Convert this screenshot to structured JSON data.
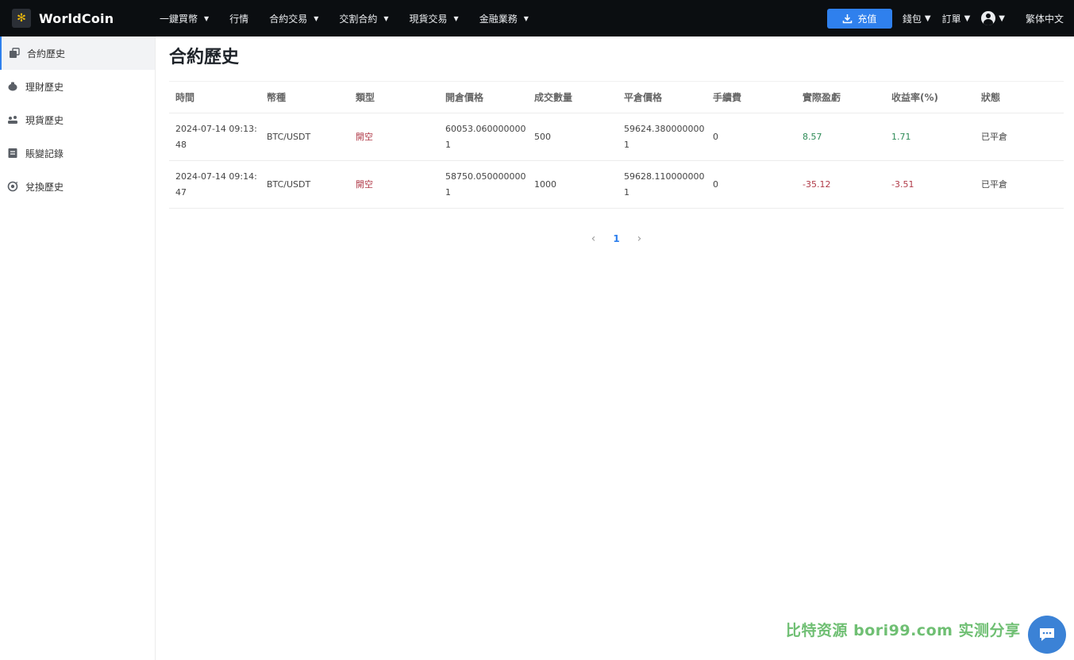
{
  "header": {
    "brand": "WorldCoin",
    "nav": [
      {
        "label": "一鍵買幣",
        "has_caret": true
      },
      {
        "label": "行情",
        "has_caret": false
      },
      {
        "label": "合約交易",
        "has_caret": true
      },
      {
        "label": "交割合約",
        "has_caret": true
      },
      {
        "label": "現貨交易",
        "has_caret": true
      },
      {
        "label": "金融業務",
        "has_caret": true
      }
    ],
    "deposit_label": "充值",
    "wallet_label": "錢包",
    "orders_label": "訂單",
    "language_label": "繁体中文"
  },
  "sidebar": {
    "items": [
      {
        "label": "合約歷史",
        "icon": "contract-icon",
        "active": true
      },
      {
        "label": "理財歷史",
        "icon": "piggy-bank-icon",
        "active": false
      },
      {
        "label": "現貨歷史",
        "icon": "spot-icon",
        "active": false
      },
      {
        "label": "賬變記錄",
        "icon": "ledger-icon",
        "active": false
      },
      {
        "label": "兌換歷史",
        "icon": "exchange-icon",
        "active": false
      }
    ]
  },
  "main": {
    "title": "合約歷史",
    "table": {
      "columns": [
        "時間",
        "幣種",
        "類型",
        "開倉價格",
        "成交數量",
        "平倉價格",
        "手續費",
        "實際盈虧",
        "收益率(%)",
        "狀態"
      ],
      "rows": [
        {
          "time": "2024-07-14 09:13:48",
          "pair": "BTC/USDT",
          "type": "開空",
          "open_price": "60053.0600000001",
          "quantity": "500",
          "close_price": "59624.3800000001",
          "fee": "0",
          "pnl": "8.57",
          "rate": "1.71",
          "status": "已平倉"
        },
        {
          "time": "2024-07-14 09:14:47",
          "pair": "BTC/USDT",
          "type": "開空",
          "open_price": "58750.0500000001",
          "quantity": "1000",
          "close_price": "59628.1100000001",
          "fee": "0",
          "pnl": "-35.12",
          "rate": "-3.51",
          "status": "已平倉"
        }
      ]
    },
    "pagination": {
      "current": "1"
    }
  },
  "watermark": "比特资源 bori99.com 实测分享",
  "colors": {
    "accent": "#2f80ed",
    "topbar": "#0b0e11",
    "profit": "#2e8b57",
    "loss": "#b03a48"
  }
}
